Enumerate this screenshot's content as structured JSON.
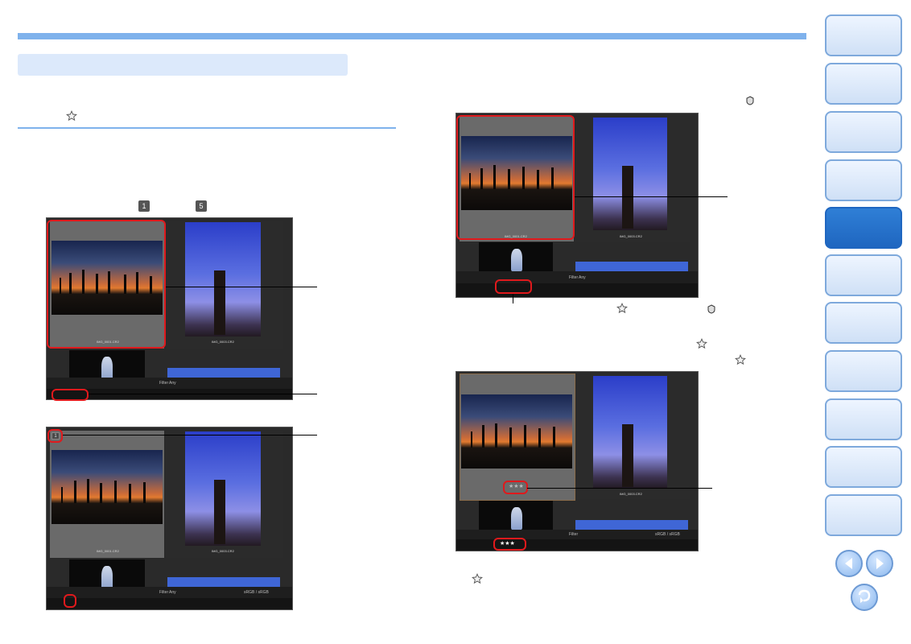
{
  "sidebar": {
    "tabs": [
      {
        "label": "",
        "active": false
      },
      {
        "label": "",
        "active": false
      },
      {
        "label": "",
        "active": false
      },
      {
        "label": "",
        "active": false
      },
      {
        "label": "",
        "active": true
      },
      {
        "label": "",
        "active": false
      },
      {
        "label": "",
        "active": false
      },
      {
        "label": "",
        "active": false
      },
      {
        "label": "",
        "active": false
      },
      {
        "label": "",
        "active": false
      },
      {
        "label": "",
        "active": false
      }
    ]
  },
  "icons": {
    "prev": "left-arrow-icon",
    "next": "right-arrow-icon",
    "back": "return-icon",
    "star": "star-icon",
    "check1": "check-mark-1-icon",
    "check5": "check-mark-5-icon"
  },
  "inline_labels": {
    "check_1": "1",
    "check_5": "5"
  },
  "screens": {
    "filename_a": "IMG_0001.CR2",
    "filename_b": "IMG_0003.CR2",
    "filter_label": "Filter",
    "filter_value": "Any",
    "colorspace": "sRGB / sRGB",
    "stars_display": "★★★",
    "check_badge": "1"
  },
  "colors": {
    "accent": "#7fb2ec",
    "highlight": "#e0191c",
    "active_tab": "#1f66c0"
  }
}
